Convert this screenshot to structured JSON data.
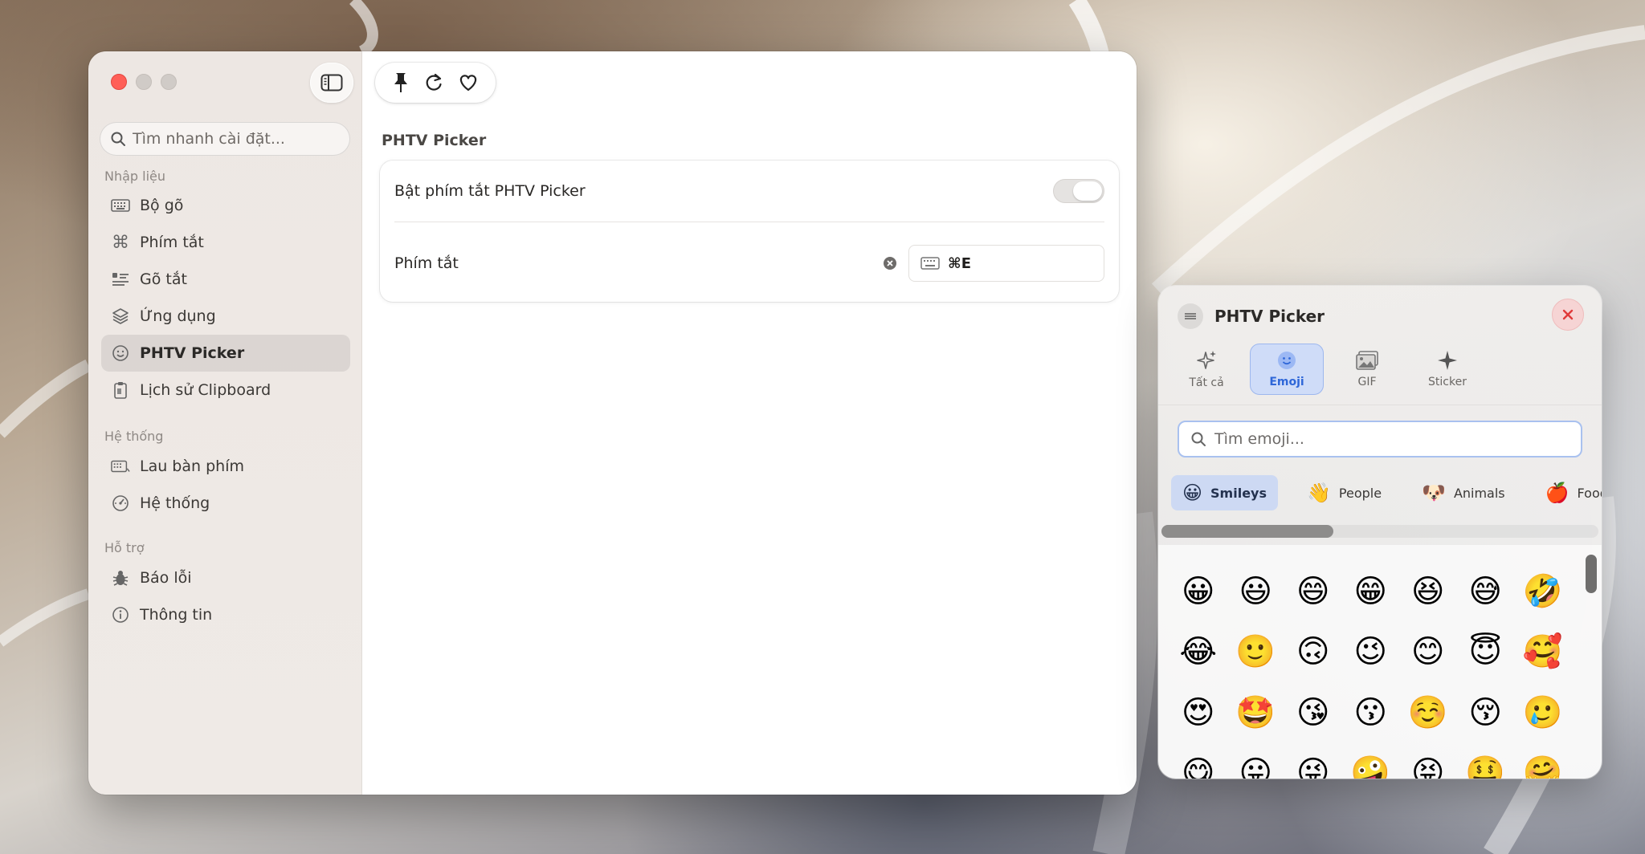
{
  "settings": {
    "search_placeholder": "Tìm nhanh cài đặt...",
    "sections": [
      {
        "label": "Nhập liệu"
      },
      {
        "label": "Hệ thống"
      },
      {
        "label": "Hỗ trợ"
      }
    ],
    "nav_items": [
      {
        "label": "Bộ gõ",
        "icon": "keyboard-icon"
      },
      {
        "label": "Phím tắt",
        "icon": "command-icon"
      },
      {
        "label": "Gõ tắt",
        "icon": "text-list-icon"
      },
      {
        "label": "Ứng dụng",
        "icon": "layers-icon"
      },
      {
        "label": "PHTV Picker",
        "icon": "smiley-icon",
        "active": true
      },
      {
        "label": "Lịch sử Clipboard",
        "icon": "clipboard-icon"
      },
      {
        "label": "Lau bàn phím",
        "icon": "keyboard-clean-icon"
      },
      {
        "label": "Hệ thống",
        "icon": "system-gauge-icon"
      },
      {
        "label": "Báo lỗi",
        "icon": "bug-icon"
      },
      {
        "label": "Thông tin",
        "icon": "info-icon"
      }
    ],
    "page_title": "PHTV Picker",
    "enable_shortcut_label": "Bật phím tắt PHTV Picker",
    "enable_shortcut_on": false,
    "shortcut_label": "Phím tắt",
    "shortcut_value": "⌘E"
  },
  "picker": {
    "title": "PHTV Picker",
    "tabs": [
      {
        "label": "Tất cả",
        "icon": "sparkles-icon"
      },
      {
        "label": "Emoji",
        "icon": "emoji-face-icon",
        "active": true
      },
      {
        "label": "GIF",
        "icon": "gif-image-icon"
      },
      {
        "label": "Sticker",
        "icon": "star-sparkle-icon"
      }
    ],
    "search_placeholder": "Tìm emoji...",
    "categories": [
      {
        "label": "Smileys",
        "emoji": "😀",
        "active": true
      },
      {
        "label": "People",
        "emoji": "👋"
      },
      {
        "label": "Animals",
        "emoji": "🐶"
      },
      {
        "label": "Food",
        "emoji": "🍎"
      }
    ],
    "emojis": [
      "😀",
      "😃",
      "😄",
      "😁",
      "😆",
      "😅",
      "🤣",
      "😂",
      "🙂",
      "🙃",
      "😉",
      "😊",
      "😇",
      "🥰",
      "😍",
      "🤩",
      "😘",
      "😗",
      "☺️",
      "😚",
      "🥲",
      "😋",
      "😛",
      "😜",
      "🤪",
      "😝",
      "🤑",
      "🤗"
    ]
  },
  "colors": {
    "accent_blue": "#2f67d8",
    "close_red": "#ff5f57"
  }
}
